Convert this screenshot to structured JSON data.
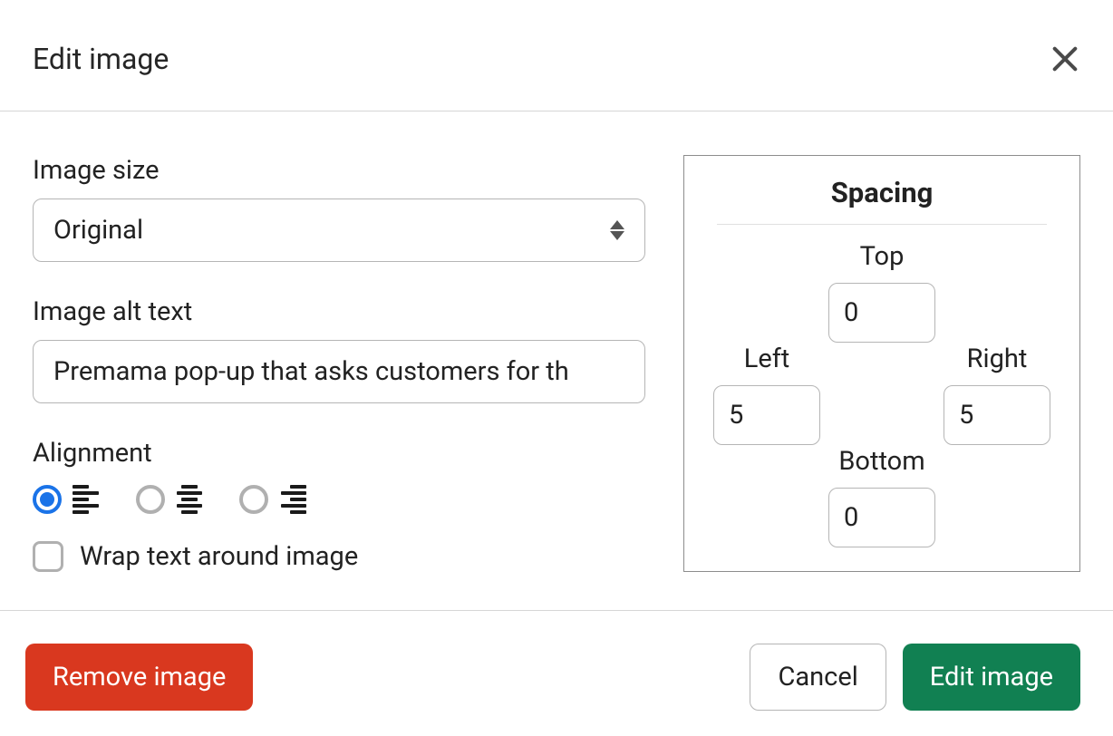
{
  "dialog": {
    "title": "Edit image"
  },
  "form": {
    "imageSizeLabel": "Image size",
    "imageSizeValue": "Original",
    "altTextLabel": "Image alt text",
    "altTextValue": "Premama pop-up that asks customers for th",
    "alignmentLabel": "Alignment",
    "wrapLabel": "Wrap text around image"
  },
  "spacing": {
    "title": "Spacing",
    "topLabel": "Top",
    "topValue": "0",
    "bottomLabel": "Bottom",
    "bottomValue": "0",
    "leftLabel": "Left",
    "leftValue": "5",
    "rightLabel": "Right",
    "rightValue": "5"
  },
  "actions": {
    "remove": "Remove image",
    "cancel": "Cancel",
    "confirm": "Edit image"
  }
}
